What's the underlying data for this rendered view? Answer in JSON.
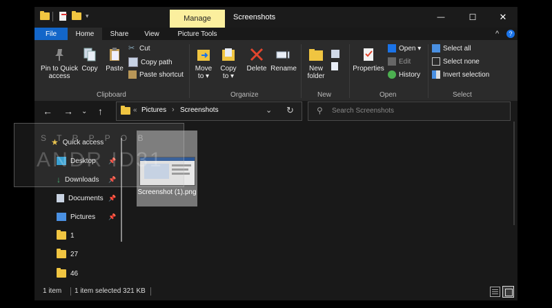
{
  "titlebar": {
    "manage": "Manage",
    "title": "Screenshots",
    "minimize": "—",
    "maximize": "☐",
    "close": "✕"
  },
  "tabs": [
    "File",
    "Home",
    "Share",
    "View",
    "Picture Tools"
  ],
  "tab_right": {
    "collapse": "^",
    "help": "?"
  },
  "clipboard": {
    "pin": "Pin to Quick access",
    "copy": "Copy",
    "paste": "Paste",
    "cut": "Cut",
    "copy_path": "Copy path",
    "paste_shortcut": "Paste shortcut",
    "label": "Clipboard"
  },
  "organize": {
    "move_to": "Move to ▾",
    "copy_to": "Copy to ▾",
    "delete": "Delete",
    "rename": "Rename",
    "label": "Organize"
  },
  "new": {
    "new_folder": "New folder",
    "label": "New"
  },
  "open": {
    "properties": "Properties",
    "open": "Open ▾",
    "edit": "Edit",
    "history": "History",
    "label": "Open"
  },
  "select": {
    "select_all": "Select all",
    "select_none": "Select none",
    "invert": "Invert selection",
    "label": "Select"
  },
  "address": {
    "crumbs": [
      "Pictures",
      "Screenshots"
    ],
    "chevrons": "«",
    "sep": "›"
  },
  "search": {
    "placeholder": "Search Screenshots"
  },
  "nav": [
    {
      "label": "Quick access",
      "icon": "star-icon"
    },
    {
      "label": "Desktop",
      "icon": "desktop-icon",
      "pinned": true
    },
    {
      "label": "Downloads",
      "icon": "download-icon",
      "pinned": true
    },
    {
      "label": "Documents",
      "icon": "documents-icon",
      "pinned": true
    },
    {
      "label": "Pictures",
      "icon": "pictures-icon",
      "pinned": true
    },
    {
      "label": "1",
      "icon": "folder-icon"
    },
    {
      "label": "27",
      "icon": "folder-icon"
    },
    {
      "label": "46",
      "icon": "folder-icon"
    }
  ],
  "file": {
    "name": "Screenshot (1).png"
  },
  "status": {
    "items": "1 item",
    "selected": "1 item selected  321 KB"
  },
  "watermark": {
    "line1": "S T   R   P P O B",
    "line2": "ANDR  ID31"
  },
  "colors": {
    "file_tab": "#1366c9",
    "manage": "#fbef9e",
    "folder": "#f0c541"
  }
}
